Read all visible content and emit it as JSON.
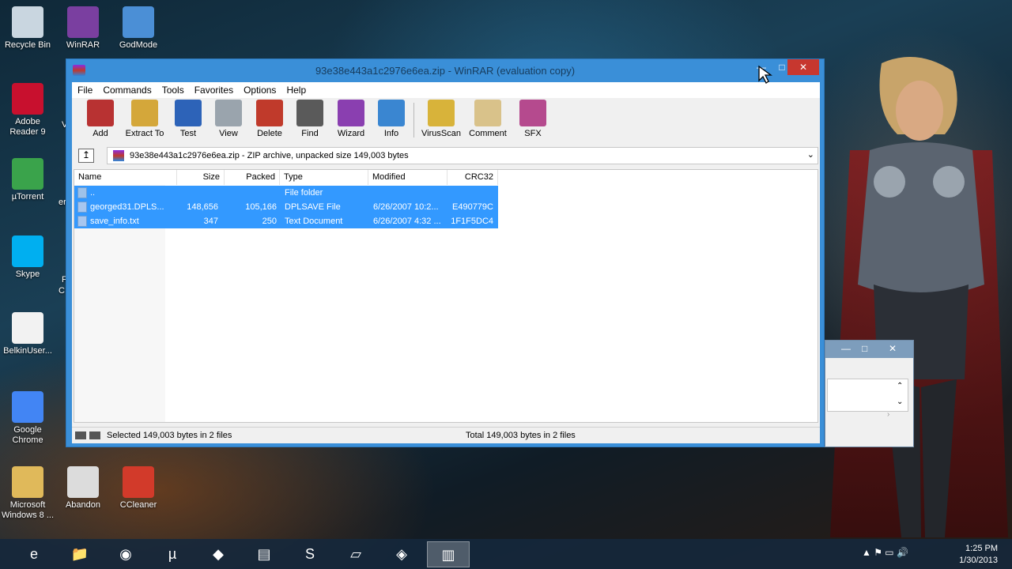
{
  "desktop": {
    "icons": [
      {
        "label": "Recycle Bin",
        "color": "#c9d6e0"
      },
      {
        "label": "WinRAR",
        "color": "#7a3fa0"
      },
      {
        "label": "GodMode",
        "color": "#4b8fd6"
      },
      {
        "label": "Adobe Reader 9",
        "color": "#c8102e"
      },
      {
        "label": "µTorrent",
        "color": "#3aa34b"
      },
      {
        "label": "Skype",
        "color": "#00aff0"
      },
      {
        "label": "BelkinUser...",
        "color": "#f2f2f2"
      },
      {
        "label": "Google Chrome",
        "color": "#4285f4"
      },
      {
        "label": "Microsoft Windows 8 ...",
        "color": "#e0b95a"
      },
      {
        "label": "Abandon",
        "color": "#dcdcdc"
      },
      {
        "label": "CCleaner",
        "color": "#d23a2a"
      }
    ],
    "partial_labels": [
      "V",
      "er",
      "F",
      "C"
    ]
  },
  "window": {
    "title": "93e38e443a1c2976e6ea.zip - WinRAR (evaluation copy)",
    "controls": {
      "minimize": "—",
      "maximize": "□",
      "close": "✕"
    }
  },
  "menu": [
    "File",
    "Commands",
    "Tools",
    "Favorites",
    "Options",
    "Help"
  ],
  "toolbar": [
    {
      "label": "Add",
      "color": "#b83232"
    },
    {
      "label": "Extract To",
      "color": "#d4a73a"
    },
    {
      "label": "Test",
      "color": "#2d63b8"
    },
    {
      "label": "View",
      "color": "#9aa4ad"
    },
    {
      "label": "Delete",
      "color": "#c03a2b"
    },
    {
      "label": "Find",
      "color": "#5a5a5a"
    },
    {
      "label": "Wizard",
      "color": "#8a3fb0"
    },
    {
      "label": "Info",
      "color": "#3a86d1"
    },
    {
      "label": "VirusScan",
      "color": "#d8b33a"
    },
    {
      "label": "Comment",
      "color": "#d9c28a"
    },
    {
      "label": "SFX",
      "color": "#b54a8e"
    }
  ],
  "address": {
    "up_glyph": "↥",
    "path": "93e38e443a1c2976e6ea.zip - ZIP archive, unpacked size 149,003 bytes",
    "dropdown": "⌄"
  },
  "columns": [
    "Name",
    "Size",
    "Packed",
    "Type",
    "Modified",
    "CRC32"
  ],
  "files": [
    {
      "name": "..",
      "size": "",
      "packed": "",
      "type": "File folder",
      "modified": "",
      "crc": "",
      "folder": true
    },
    {
      "name": "georged31.DPLS...",
      "size": "148,656",
      "packed": "105,166",
      "type": "DPLSAVE File",
      "modified": "6/26/2007 10:2...",
      "crc": "E490779C"
    },
    {
      "name": "save_info.txt",
      "size": "347",
      "packed": "250",
      "type": "Text Document",
      "modified": "6/26/2007 4:32 ...",
      "crc": "1F1F5DC4"
    }
  ],
  "status": {
    "left": "Selected 149,003 bytes in 2 files",
    "right": "Total 149,003 bytes in 2 files"
  },
  "window2": {
    "min": "—",
    "max": "□",
    "close": "✕",
    "up": "⌃",
    "down": "⌄",
    "right": "›"
  },
  "taskbar": {
    "items": [
      {
        "name": "internet-explorer",
        "glyph": "e"
      },
      {
        "name": "file-explorer",
        "glyph": "📁"
      },
      {
        "name": "chrome",
        "glyph": "◉"
      },
      {
        "name": "utorrent",
        "glyph": "µ"
      },
      {
        "name": "app5",
        "glyph": "◆"
      },
      {
        "name": "app6",
        "glyph": "▤"
      },
      {
        "name": "skype",
        "glyph": "S"
      },
      {
        "name": "app8",
        "glyph": "▱"
      },
      {
        "name": "app9",
        "glyph": "◈"
      },
      {
        "name": "winrar",
        "glyph": "▥",
        "active": true
      }
    ],
    "tray": "▲  ⚑  ▭  🔊",
    "time": "1:25 PM",
    "date": "1/30/2013"
  }
}
